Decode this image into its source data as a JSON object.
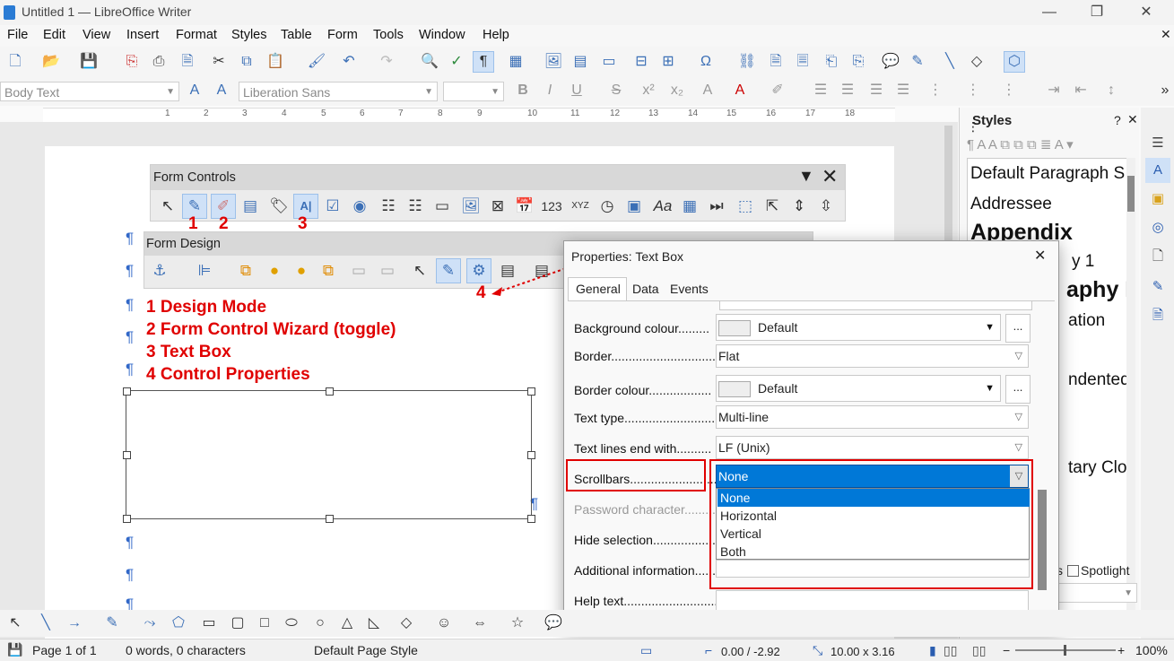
{
  "window": {
    "title": "Untitled 1 — LibreOffice Writer"
  },
  "menu": [
    "File",
    "Edit",
    "View",
    "Insert",
    "Format",
    "Styles",
    "Table",
    "Form",
    "Tools",
    "Window",
    "Help"
  ],
  "formatting": {
    "paragraph_style": "Body Text",
    "font_name": "Liberation Sans",
    "font_size": ""
  },
  "ruler": {
    "numbers": [
      "1",
      "2",
      "3",
      "4",
      "5",
      "6",
      "7",
      "8",
      "9",
      "10",
      "11",
      "12",
      "13",
      "14",
      "15",
      "16",
      "17",
      "18"
    ]
  },
  "form_controls": {
    "title": "Form Controls",
    "markers": [
      "1",
      "2",
      "3"
    ]
  },
  "form_design": {
    "title": "Form Design",
    "marker": "4"
  },
  "legend": [
    "1 Design Mode",
    "2 Form Control Wizard (toggle)",
    "3 Text Box",
    "4 Control Properties"
  ],
  "styles_panel": {
    "title": "Styles",
    "items": [
      "Default Paragraph S",
      "Addressee",
      "Appendix",
      "y 1",
      "aphy I",
      "ation",
      "ndented",
      "tary Clos"
    ],
    "spotlight": "Spotlight",
    "partial_checkbox": "s"
  },
  "dialog": {
    "title": "Properties: Text Box",
    "tabs": [
      "General",
      "Data",
      "Events"
    ],
    "rows": {
      "background_colour": {
        "label": "Background colour.........",
        "value": "Default"
      },
      "border": {
        "label": "Border...............................",
        "value": "Flat"
      },
      "border_colour": {
        "label": "Border colour..................",
        "value": "Default"
      },
      "text_type": {
        "label": "Text type...........................",
        "value": "Multi-line"
      },
      "text_lines_end": {
        "label": "Text lines end with..........",
        "value": "LF (Unix)"
      },
      "scrollbars": {
        "label": "Scrollbars.........................",
        "value": "None"
      },
      "password": {
        "label": "Password character........."
      },
      "hide_selection": {
        "label": "Hide selection.................."
      },
      "additional_info": {
        "label": "Additional information......"
      },
      "help_text": {
        "label": "Help text..........................."
      }
    },
    "scrollbar_options": [
      "None",
      "Horizontal",
      "Vertical",
      "Both"
    ],
    "ellipsis": "..."
  },
  "status": {
    "page": "Page 1 of 1",
    "words": "0 words, 0 characters",
    "page_style": "Default Page Style",
    "position": "0.00 / -2.92",
    "size": "10.00 x 3.16",
    "zoom": "100%"
  },
  "colors": {
    "accent": "#0078d7",
    "annotation": "#e00000"
  }
}
